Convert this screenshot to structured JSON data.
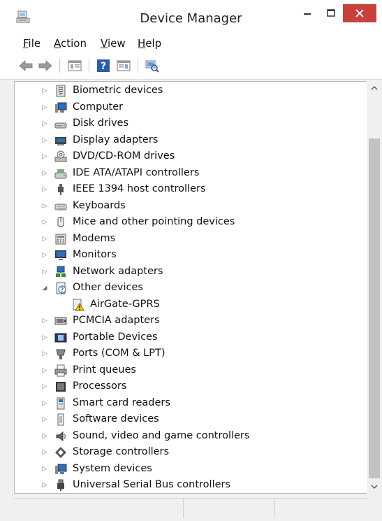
{
  "window": {
    "title": "Device Manager"
  },
  "menubar": {
    "items": [
      "File",
      "Action",
      "View",
      "Help"
    ]
  },
  "tree": {
    "items": [
      {
        "label": "Biometric devices",
        "icon": "biometric-icon",
        "expanded": false,
        "level": 0
      },
      {
        "label": "Computer",
        "icon": "computer-icon",
        "expanded": false,
        "level": 0
      },
      {
        "label": "Disk drives",
        "icon": "disk-drive-icon",
        "expanded": false,
        "level": 0
      },
      {
        "label": "Display adapters",
        "icon": "display-adapter-icon",
        "expanded": false,
        "level": 0
      },
      {
        "label": "DVD/CD-ROM drives",
        "icon": "dvd-drive-icon",
        "expanded": false,
        "level": 0
      },
      {
        "label": "IDE ATA/ATAPI controllers",
        "icon": "ide-controller-icon",
        "expanded": false,
        "level": 0
      },
      {
        "label": "IEEE 1394 host controllers",
        "icon": "ieee1394-icon",
        "expanded": false,
        "level": 0
      },
      {
        "label": "Keyboards",
        "icon": "keyboard-icon",
        "expanded": false,
        "level": 0
      },
      {
        "label": "Mice and other pointing devices",
        "icon": "mouse-icon",
        "expanded": false,
        "level": 0
      },
      {
        "label": "Modems",
        "icon": "modem-icon",
        "expanded": false,
        "level": 0
      },
      {
        "label": "Monitors",
        "icon": "monitor-icon",
        "expanded": false,
        "level": 0
      },
      {
        "label": "Network adapters",
        "icon": "network-adapter-icon",
        "expanded": false,
        "level": 0
      },
      {
        "label": "Other devices",
        "icon": "other-devices-icon",
        "expanded": true,
        "level": 0
      },
      {
        "label": "AirGate-GPRS",
        "icon": "warning-device-icon",
        "expanded": null,
        "level": 1
      },
      {
        "label": "PCMCIA adapters",
        "icon": "pcmcia-icon",
        "expanded": false,
        "level": 0
      },
      {
        "label": "Portable Devices",
        "icon": "portable-device-icon",
        "expanded": false,
        "level": 0
      },
      {
        "label": "Ports (COM & LPT)",
        "icon": "port-icon",
        "expanded": false,
        "level": 0
      },
      {
        "label": "Print queues",
        "icon": "printer-icon",
        "expanded": false,
        "level": 0
      },
      {
        "label": "Processors",
        "icon": "processor-icon",
        "expanded": false,
        "level": 0
      },
      {
        "label": "Smart card readers",
        "icon": "smart-card-icon",
        "expanded": false,
        "level": 0
      },
      {
        "label": "Software devices",
        "icon": "software-device-icon",
        "expanded": false,
        "level": 0
      },
      {
        "label": "Sound, video and game controllers",
        "icon": "sound-icon",
        "expanded": false,
        "level": 0
      },
      {
        "label": "Storage controllers",
        "icon": "storage-controller-icon",
        "expanded": false,
        "level": 0
      },
      {
        "label": "System devices",
        "icon": "system-device-icon",
        "expanded": false,
        "level": 0
      },
      {
        "label": "Universal Serial Bus controllers",
        "icon": "usb-icon",
        "expanded": false,
        "level": 0
      }
    ]
  },
  "colors": {
    "close_button": "#c7413d",
    "scroll_thumb": "#c2c2c2",
    "warning": "#f5c518"
  }
}
